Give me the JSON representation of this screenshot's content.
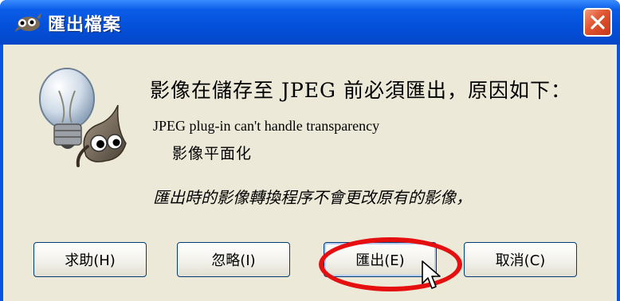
{
  "window": {
    "title": "匯出檔案",
    "icon": "gimp-icon",
    "close_icon": "close-icon"
  },
  "dialog": {
    "icon": "gimp-lightbulb-icon",
    "heading": "影像在儲存至 JPEG 前必須匯出，原因如下：",
    "reason": "JPEG plug-in can't handle transparency",
    "action": "影像平面化",
    "note": "匯出時的影像轉換程序不會更改原有的影像，"
  },
  "buttons": {
    "help": "求助(H)",
    "ignore": "忽略(I)",
    "export": "匯出(E)",
    "cancel": "取消(C)"
  },
  "annotation": {
    "highlight_color": "#e60f0f",
    "highlighted_button": "export"
  },
  "colors": {
    "titlebar": "#0350d9",
    "client_bg": "#ece9d8",
    "close_button": "#e0542e"
  }
}
